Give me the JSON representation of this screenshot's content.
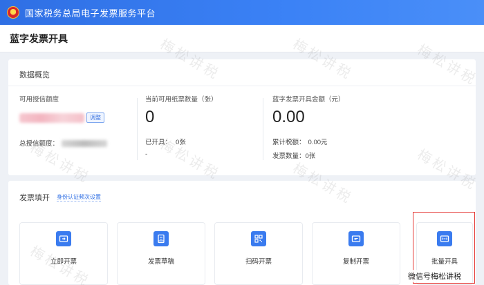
{
  "header": {
    "site_title": "国家税务总局电子发票服务平台",
    "emblem_glyph": "★",
    "emblem_icon": "national-emblem-icon"
  },
  "page": {
    "title": "蓝字发票开具"
  },
  "overview": {
    "title": "数据概览",
    "credit": {
      "label": "可用授信额度",
      "adjust_label": "调整",
      "total_label": "总授信额度："
    },
    "paper": {
      "label": "当前可用纸票数量（张）",
      "value": "0",
      "issued_label": "已开具：",
      "issued_value": "0张",
      "dash": "-"
    },
    "amount": {
      "label": "蓝字发票开具金额（元）",
      "value": "0.00",
      "tax_label": "累计税额：",
      "tax_value": "0.00元",
      "count_label": "发票数量：",
      "count_value": "0张"
    }
  },
  "fill": {
    "title": "发票填开",
    "link": "身份认证频次设置",
    "tiles": [
      {
        "label": "立即开票",
        "icon": "issue-now-icon"
      },
      {
        "label": "发票草稿",
        "icon": "draft-icon"
      },
      {
        "label": "扫码开票",
        "icon": "qr-code-icon"
      },
      {
        "label": "复制开票",
        "icon": "copy-invoice-icon"
      },
      {
        "label": "批量开具",
        "icon": "batch-issue-icon"
      }
    ]
  },
  "watermark": {
    "text": "梅松讲税"
  },
  "credit_overlay": {
    "text": "微信号梅松讲税"
  },
  "colors": {
    "primary": "#3a7bef",
    "highlight": "#e53935"
  }
}
